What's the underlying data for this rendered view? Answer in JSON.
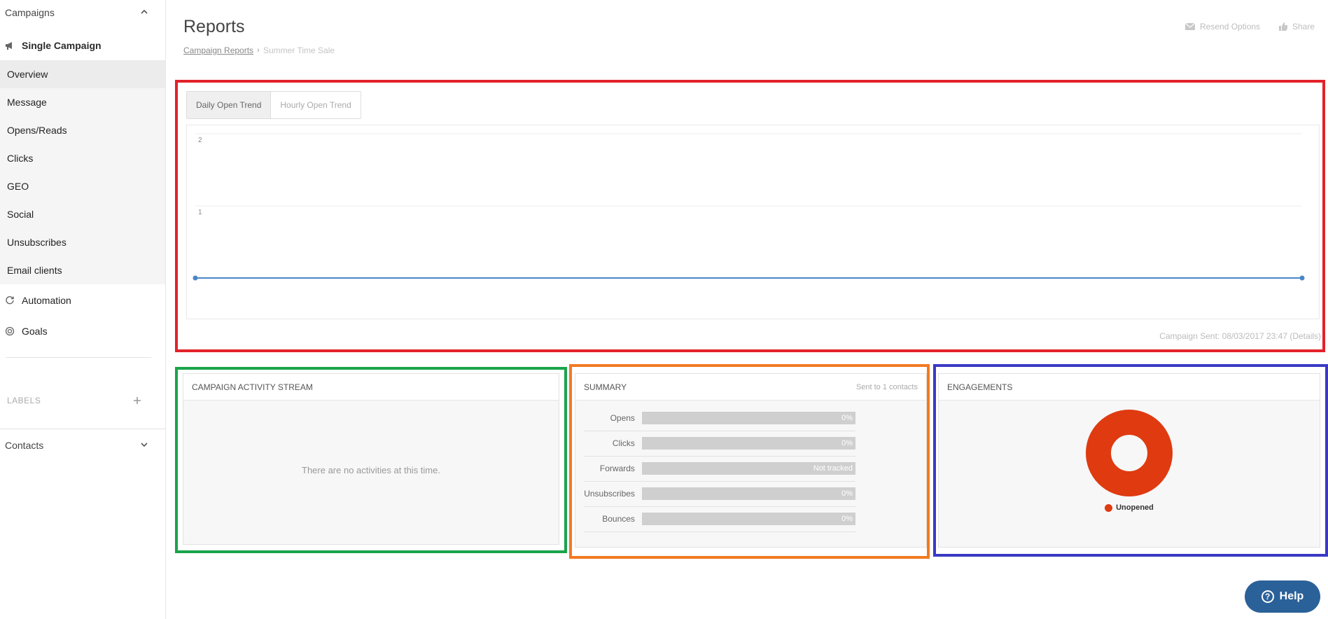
{
  "sidebar": {
    "campaigns_label": "Campaigns",
    "single_campaign_label": "Single Campaign",
    "sub_items": [
      {
        "label": "Overview",
        "active": true
      },
      {
        "label": "Message"
      },
      {
        "label": "Opens/Reads"
      },
      {
        "label": "Clicks"
      },
      {
        "label": "GEO"
      },
      {
        "label": "Social"
      },
      {
        "label": "Unsubscribes"
      },
      {
        "label": "Email clients"
      }
    ],
    "automation_label": "Automation",
    "goals_label": "Goals",
    "labels_label": "LABELS",
    "contacts_label": "Contacts"
  },
  "header": {
    "title": "Reports",
    "breadcrumb_link": "Campaign Reports",
    "breadcrumb_sep": "›",
    "breadcrumb_current": "Summer Time Sale",
    "resend_label": "Resend Options",
    "share_label": "Share"
  },
  "trend": {
    "tabs": [
      "Daily Open Trend",
      "Hourly Open Trend"
    ],
    "active_tab": 0,
    "sent_text": "Campaign Sent: 08/03/2017 23:47 (Details)"
  },
  "chart_data": {
    "type": "line",
    "ylim": [
      0,
      2
    ],
    "yticks": [
      "2",
      "1"
    ],
    "series": [
      {
        "values": [
          0,
          0
        ]
      }
    ],
    "line_color": "#4a86c8"
  },
  "activity": {
    "title": "CAMPAIGN ACTIVITY STREAM",
    "empty_message": "There are no activities at this time."
  },
  "summary": {
    "title": "SUMMARY",
    "sent_to": "Sent to 1 contacts",
    "rows": [
      {
        "label": "Opens",
        "value": "0%"
      },
      {
        "label": "Clicks",
        "value": "0%"
      },
      {
        "label": "Forwards",
        "value": "Not tracked"
      },
      {
        "label": "Unsubscribes",
        "value": "0%"
      },
      {
        "label": "Bounces",
        "value": "0%"
      }
    ]
  },
  "engagements": {
    "title": "ENGAGEMENTS",
    "legend_label": "Unopened",
    "slices": [
      {
        "label": "Unopened",
        "value": 100,
        "color": "#e03a10"
      }
    ]
  },
  "help": {
    "label": "Help"
  },
  "colors": {
    "accent": "#2b6199",
    "highlight_red": "#e2222a",
    "highlight_green": "#1aa44a",
    "highlight_orange": "#f27a22",
    "highlight_blue": "#3a3ac4"
  }
}
